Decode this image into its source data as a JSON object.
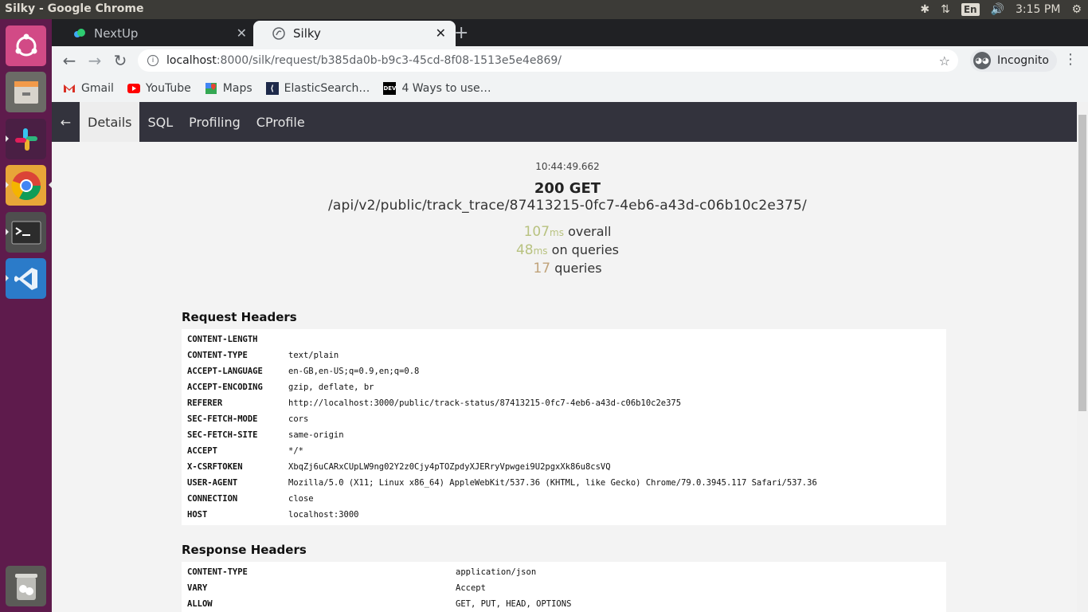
{
  "os": {
    "window_title": "Silky - Google Chrome",
    "keyboard_lang": "En",
    "clock": "3:15 PM"
  },
  "launcher": {
    "items": [
      "ubuntu-dash",
      "files",
      "slack",
      "chrome",
      "terminal",
      "vscode",
      "trash"
    ]
  },
  "browser": {
    "tabs": [
      {
        "title": "NextUp",
        "active": false
      },
      {
        "title": "Silky",
        "active": true
      }
    ],
    "url_host": "localhost",
    "url_rest": ":8000/silk/request/b385da0b-b9c3-45cd-8f08-1513e5e4e869/",
    "incognito_label": "Incognito",
    "bookmarks": [
      {
        "label": "Gmail",
        "icon": "gmail-icon",
        "color": "#d93025"
      },
      {
        "label": "YouTube",
        "icon": "youtube-icon",
        "color": "#ff0000"
      },
      {
        "label": "Maps",
        "icon": "maps-icon",
        "color": "#34a853"
      },
      {
        "label": "ElasticSearch…",
        "icon": "elasticsearch-icon",
        "color": "#1e2a4a"
      },
      {
        "label": "4 Ways to use…",
        "icon": "dev-icon",
        "color": "#000000"
      }
    ]
  },
  "silk": {
    "nav": {
      "back": "←",
      "items": [
        "Details",
        "SQL",
        "Profiling",
        "CProfile"
      ],
      "active": "Details"
    },
    "summary": {
      "time": "10:44:49.662",
      "status": "200 GET",
      "path": "/api/v2/public/track_trace/87413215-0fc7-4eb6-a43d-c06b10c2e375/",
      "overall_value": "107",
      "overall_unit": "ms",
      "overall_label": "overall",
      "queries_time_value": "48",
      "queries_time_unit": "ms",
      "queries_time_label": "on queries",
      "queries_count": "17",
      "queries_count_label": "queries"
    },
    "request_headers_title": "Request Headers",
    "request_headers": [
      {
        "key": "CONTENT-LENGTH",
        "value": ""
      },
      {
        "key": "CONTENT-TYPE",
        "value": "text/plain"
      },
      {
        "key": "ACCEPT-LANGUAGE",
        "value": "en-GB,en-US;q=0.9,en;q=0.8"
      },
      {
        "key": "ACCEPT-ENCODING",
        "value": "gzip, deflate, br"
      },
      {
        "key": "REFERER",
        "value": "http://localhost:3000/public/track-status/87413215-0fc7-4eb6-a43d-c06b10c2e375"
      },
      {
        "key": "SEC-FETCH-MODE",
        "value": "cors"
      },
      {
        "key": "SEC-FETCH-SITE",
        "value": "same-origin"
      },
      {
        "key": "ACCEPT",
        "value": "*/*"
      },
      {
        "key": "X-CSRFTOKEN",
        "value": "XbqZj6uCARxCUpLW9ng02Y2z0Cjy4pTOZpdyXJERryVpwgei9U2pgxXk86u8csVQ"
      },
      {
        "key": "USER-AGENT",
        "value": "Mozilla/5.0 (X11; Linux x86_64) AppleWebKit/537.36 (KHTML, like Gecko) Chrome/79.0.3945.117 Safari/537.36"
      },
      {
        "key": "CONNECTION",
        "value": "close"
      },
      {
        "key": "HOST",
        "value": "localhost:3000"
      }
    ],
    "response_headers_title": "Response Headers",
    "response_headers": [
      {
        "key": "CONTENT-TYPE",
        "value": "application/json"
      },
      {
        "key": "VARY",
        "value": "Accept"
      },
      {
        "key": "ALLOW",
        "value": "GET, PUT, HEAD, OPTIONS"
      }
    ]
  }
}
